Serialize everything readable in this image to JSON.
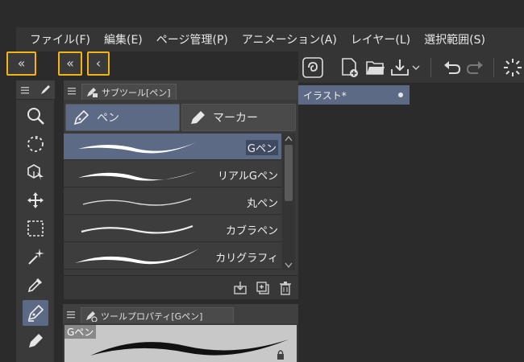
{
  "menu": {
    "items": [
      {
        "label": "ファイル(F)"
      },
      {
        "label": "編集(E)"
      },
      {
        "label": "ページ管理(P)"
      },
      {
        "label": "アニメーション(A)"
      },
      {
        "label": "レイヤー(L)"
      },
      {
        "label": "選択範囲(S)"
      }
    ]
  },
  "collapse_buttons": {
    "collapse_all": "«",
    "collapse_column": "«",
    "collapse_panel": "‹"
  },
  "tools": [
    {
      "icon": "zoom-icon"
    },
    {
      "icon": "move-canvas-icon"
    },
    {
      "icon": "operation-object-icon"
    },
    {
      "icon": "layer-move-icon"
    },
    {
      "icon": "selection-icon"
    },
    {
      "icon": "auto-select-icon"
    },
    {
      "icon": "eyedropper-icon"
    },
    {
      "icon": "pen-icon",
      "active": true
    },
    {
      "icon": "pencil-icon"
    }
  ],
  "subtool": {
    "tab_label": "サブツール[ペン]",
    "groups": [
      {
        "label": "ペン",
        "active": true
      },
      {
        "label": "マーカー",
        "active": false
      }
    ],
    "brushes": [
      {
        "name": "Gペン",
        "selected": true
      },
      {
        "name": "リアルGペン",
        "selected": false
      },
      {
        "name": "丸ペン",
        "selected": false
      },
      {
        "name": "カブラペン",
        "selected": false
      },
      {
        "name": "カリグラフィ",
        "selected": false
      }
    ]
  },
  "tool_property": {
    "tab_label": "ツールプロパティ[Gペン]",
    "preview_name": "Gペン"
  },
  "document": {
    "tab_label": "イラスト*"
  },
  "colors": {
    "accent_highlight": "#f2b418",
    "selection": "#5d6a86",
    "panel": "#3a3a3a",
    "background": "#2b2b2b"
  }
}
